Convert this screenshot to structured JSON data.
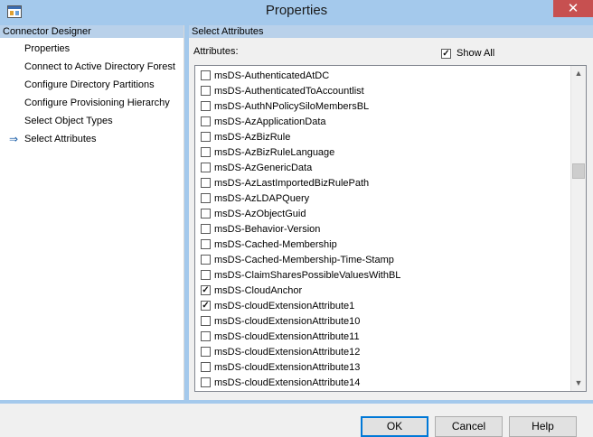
{
  "window": {
    "title": "Properties",
    "close_glyph": "✕",
    "icon": "app-window-icon"
  },
  "left_pane": {
    "header": "Connector Designer",
    "items": [
      {
        "label": "Properties",
        "selected": false
      },
      {
        "label": "Connect to Active Directory Forest",
        "selected": false
      },
      {
        "label": "Configure Directory Partitions",
        "selected": false
      },
      {
        "label": "Configure Provisioning Hierarchy",
        "selected": false
      },
      {
        "label": "Select Object Types",
        "selected": false
      },
      {
        "label": "Select Attributes",
        "selected": true
      }
    ],
    "current_arrow": "⇒"
  },
  "right_pane": {
    "header": "Select Attributes",
    "attributes_label": "Attributes:",
    "show_all": {
      "label": "Show All",
      "checked": true
    },
    "attributes": [
      {
        "name": "msDS-AuthenticatedAtDC",
        "checked": false
      },
      {
        "name": "msDS-AuthenticatedToAccountlist",
        "checked": false
      },
      {
        "name": "msDS-AuthNPolicySiloMembersBL",
        "checked": false
      },
      {
        "name": "msDS-AzApplicationData",
        "checked": false
      },
      {
        "name": "msDS-AzBizRule",
        "checked": false
      },
      {
        "name": "msDS-AzBizRuleLanguage",
        "checked": false
      },
      {
        "name": "msDS-AzGenericData",
        "checked": false
      },
      {
        "name": "msDS-AzLastImportedBizRulePath",
        "checked": false
      },
      {
        "name": "msDS-AzLDAPQuery",
        "checked": false
      },
      {
        "name": "msDS-AzObjectGuid",
        "checked": false
      },
      {
        "name": "msDS-Behavior-Version",
        "checked": false
      },
      {
        "name": "msDS-Cached-Membership",
        "checked": false
      },
      {
        "name": "msDS-Cached-Membership-Time-Stamp",
        "checked": false
      },
      {
        "name": "msDS-ClaimSharesPossibleValuesWithBL",
        "checked": false
      },
      {
        "name": "msDS-CloudAnchor",
        "checked": true
      },
      {
        "name": "msDS-cloudExtensionAttribute1",
        "checked": true
      },
      {
        "name": "msDS-cloudExtensionAttribute10",
        "checked": false
      },
      {
        "name": "msDS-cloudExtensionAttribute11",
        "checked": false
      },
      {
        "name": "msDS-cloudExtensionAttribute12",
        "checked": false
      },
      {
        "name": "msDS-cloudExtensionAttribute13",
        "checked": false
      },
      {
        "name": "msDS-cloudExtensionAttribute14",
        "checked": false
      }
    ],
    "scroll_up_glyph": "▲",
    "scroll_down_glyph": "▼"
  },
  "footer": {
    "ok_label": "OK",
    "cancel_label": "Cancel",
    "help_label": "Help"
  },
  "colors": {
    "title_bar": "#a4c9ec",
    "close_button": "#c75050",
    "pane_header": "#b9d1ea",
    "arrow": "#1c5fa8"
  }
}
